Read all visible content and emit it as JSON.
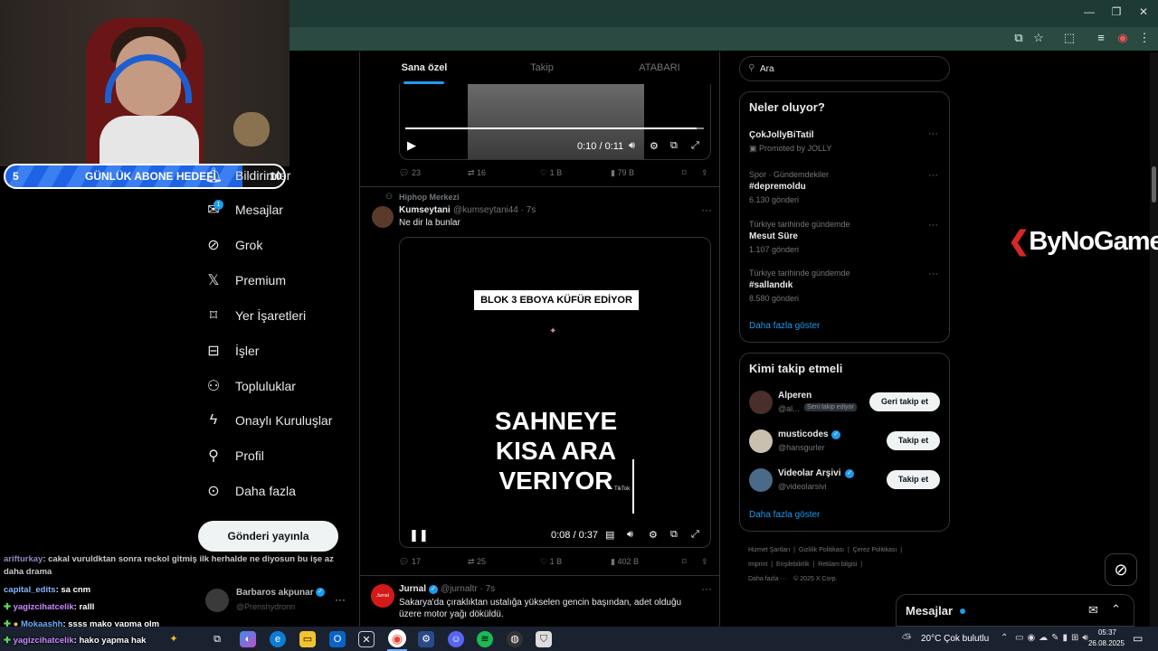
{
  "browser": {
    "window_buttons": [
      "—",
      "❐",
      "✕"
    ],
    "toolbar_icons": [
      "install-icon",
      "star-icon",
      "extensions-icon",
      "media-icon",
      "profile-icon",
      "menu-icon"
    ]
  },
  "stream": {
    "goal": {
      "current": "5",
      "label": "GÜNLÜK ABONE HEDEFİ",
      "target": "10",
      "progress_fraction": 0.5
    },
    "watermark": "ByNoGame",
    "chat": [
      {
        "user": "arifturkay",
        "text": ": cakal vuruldktan sonra reckol gitmiş ilk herhalde ne diyosun bu işe az daha drama"
      },
      {
        "user": "capital_edits",
        "text": ": sa cnm"
      },
      {
        "user": "yagizcihatcelik",
        "text": ": ralll"
      },
      {
        "user": "Mokaashh",
        "text": ": şşşş mako yapma olm"
      },
      {
        "user": "yagizcihatcelik",
        "text": ": hako yapma hak"
      }
    ]
  },
  "nav": {
    "items": [
      {
        "label": "Bildirimler",
        "icon": "bell-icon"
      },
      {
        "label": "Mesajlar",
        "icon": "mail-icon",
        "badge": "1"
      },
      {
        "label": "Grok",
        "icon": "grok-icon"
      },
      {
        "label": "Premium",
        "icon": "x-logo-icon"
      },
      {
        "label": "Yer İşaretleri",
        "icon": "bookmark-icon"
      },
      {
        "label": "İşler",
        "icon": "briefcase-icon"
      },
      {
        "label": "Topluluklar",
        "icon": "communities-icon"
      },
      {
        "label": "Onaylı Kuruluşlar",
        "icon": "lightning-icon"
      },
      {
        "label": "Profil",
        "icon": "person-icon"
      },
      {
        "label": "Daha fazla",
        "icon": "more-circle-icon"
      }
    ],
    "post_button": "Gönderi yayınla",
    "account": {
      "name": "Barbaros akpunar",
      "handle": "@Prenshydronn"
    }
  },
  "feed": {
    "tabs": [
      "Sana özel",
      "Takip",
      "ATABARI"
    ],
    "post1": {
      "time": "0:10 / 0:11",
      "replies": "23",
      "reposts": "16",
      "likes": "1 B",
      "views": "79 B"
    },
    "post2": {
      "context": "Hiphop Merkezi",
      "name": "Kumseytani",
      "handle": "@kumseytani44 · 7s",
      "text": "Ne dir la bunlar",
      "video_banner": "BLOK 3 EBOYA KÜFÜR EDİYOR",
      "video_caption_1": "SAHNEYE",
      "video_caption_2": "KISA ARA",
      "video_caption_3": "VERIYOR",
      "tiktok": "TikTok",
      "time": "0:08 / 0:37",
      "replies": "17",
      "reposts": "25",
      "likes": "1 B",
      "views": "402 B"
    },
    "post3": {
      "avatar_text": "Jurnal",
      "name": "Jurnal",
      "handle": "@jurnaltr · 7s",
      "text": "Sakarya'da çıraklıktan ustalığa yükselen gencin başından, adet olduğu üzere motor yağı döküldü."
    }
  },
  "search": {
    "placeholder": "Ara"
  },
  "trends": {
    "title": "Neler oluyor?",
    "items": [
      {
        "context": "",
        "name": "ÇokJollyBiTatil",
        "meta": "Promoted by JOLLY"
      },
      {
        "context": "Spor · Gündemdekiler",
        "name": "#depremoldu",
        "meta": "6.130 gönderi"
      },
      {
        "context": "Türkiye tarihinde gündemde",
        "name": "Mesut Süre",
        "meta": "1.107 gönderi"
      },
      {
        "context": "Türkiye tarihinde gündemde",
        "name": "#sallandık",
        "meta": "8.580 gönderi"
      }
    ],
    "more": "Daha fazla göster"
  },
  "who_to_follow": {
    "title": "Kimi takip etmeli",
    "items": [
      {
        "name": "Alperen",
        "handle": "@al...",
        "tag": "Seni takip ediyor",
        "button": "Geri takip et"
      },
      {
        "name": "musticodes",
        "handle": "@hansgurler",
        "tag": "",
        "button": "Takip et"
      },
      {
        "name": "Videolar Arşivi",
        "handle": "@videolarsivi",
        "tag": "",
        "button": "Takip et"
      }
    ],
    "more": "Daha fazla göster"
  },
  "footer": {
    "links": [
      "Hizmet Şartları",
      "Gizlilik Politikası",
      "Çerez Politikası",
      "Imprint",
      "Erişilebilirlik",
      "Reklam bilgisi",
      "Daha fazla ···",
      "© 2025 X Corp."
    ]
  },
  "messages_drawer": {
    "title": "Mesajlar"
  },
  "taskbar": {
    "weather": "20°C  Çok bulutlu",
    "time": "05:37",
    "date": "26.08.2025"
  },
  "colors": {
    "accent": "#1d9bf0",
    "background": "#000000",
    "goal_bar": "#1e63e3"
  }
}
